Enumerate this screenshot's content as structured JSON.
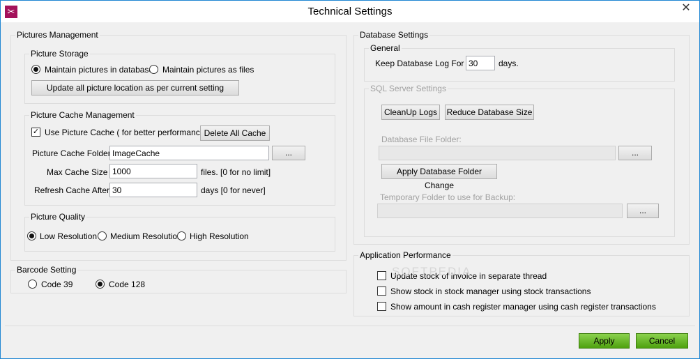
{
  "window": {
    "title": "Technical Settings",
    "app_icon": "scissors-icon",
    "close_glyph": "✕"
  },
  "pictures_management": {
    "legend": "Pictures Management",
    "picture_storage": {
      "legend": "Picture Storage",
      "option_database": "Maintain pictures in database",
      "option_files": "Maintain pictures as files",
      "selected": "database",
      "update_button": "Update all picture location as per current setting"
    },
    "picture_cache": {
      "legend": "Picture Cache Management",
      "use_cache_label": "Use Picture Cache  ( for better performance )",
      "use_cache_checked": true,
      "delete_all_button": "Delete All Cache",
      "folder_label": "Picture Cache Folder :",
      "folder_value": "ImageCache",
      "browse_button": "...",
      "max_size_label": "Max Cache Size :",
      "max_size_value": "1000",
      "max_size_suffix": "files. [0 for no limit]",
      "refresh_label": "Refresh Cache After :",
      "refresh_value": "30",
      "refresh_suffix": "days [0 for never]"
    },
    "picture_quality": {
      "legend": "Picture Quality",
      "option_low": "Low Resolution",
      "option_medium": "Medium Resolution",
      "option_high": "High Resolution",
      "selected": "low"
    }
  },
  "barcode_setting": {
    "legend": "Barcode Setting",
    "option_39": "Code 39",
    "option_128": "Code 128",
    "selected": "128"
  },
  "database_settings": {
    "legend": "Database Settings",
    "general": {
      "legend": "General",
      "keep_log_label": "Keep Database Log For  :",
      "keep_log_value": "30",
      "keep_log_suffix": "days."
    },
    "sql_server": {
      "legend": "SQL Server Settings",
      "cleanup_button": "CleanUp Logs",
      "reduce_button": "Reduce Database Size",
      "file_folder_label": "Database File Folder:",
      "file_folder_value": "",
      "file_folder_browse": "...",
      "apply_folder_button": "Apply Database Folder Change",
      "temp_folder_label": "Temporary Folder to use for Backup:",
      "temp_folder_value": "",
      "temp_folder_browse": "..."
    }
  },
  "application_performance": {
    "legend": "Application Performance",
    "option_update_stock": "Update stock of invoice in separate thread",
    "option_show_stock": "Show stock in stock manager using stock transactions",
    "option_show_amount": "Show amount in cash register manager using cash register transactions",
    "update_stock_checked": false,
    "show_stock_checked": false,
    "show_amount_checked": false
  },
  "watermark": "SOFTPEDIA",
  "footer": {
    "apply_button": "Apply",
    "cancel_button": "Cancel",
    "button_color": "#5cb21e"
  }
}
